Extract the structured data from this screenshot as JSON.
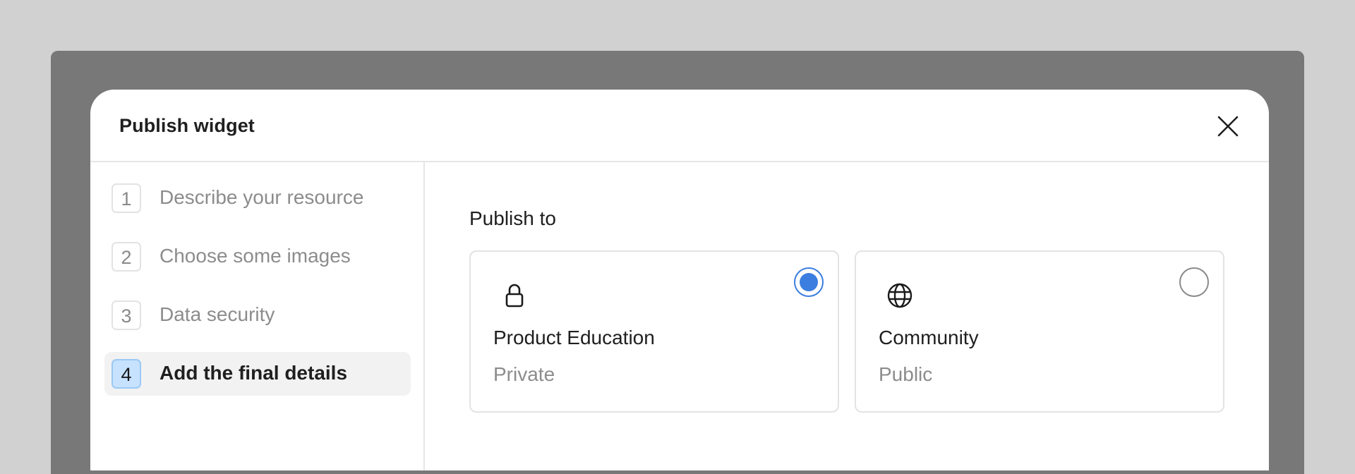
{
  "dialog": {
    "title": "Publish widget",
    "close_icon": "close-icon"
  },
  "steps": [
    {
      "number": "1",
      "label": "Describe your resource",
      "active": false
    },
    {
      "number": "2",
      "label": "Choose some images",
      "active": false
    },
    {
      "number": "3",
      "label": "Data security",
      "active": false
    },
    {
      "number": "4",
      "label": "Add the final details",
      "active": true
    }
  ],
  "publish": {
    "label": "Publish to",
    "options": [
      {
        "title": "Product Education",
        "subtitle": "Private",
        "icon": "lock-icon",
        "selected": true
      },
      {
        "title": "Community",
        "subtitle": "Public",
        "icon": "globe-icon",
        "selected": false
      }
    ]
  },
  "colors": {
    "accent": "#3b7ee0",
    "active_step_badge": "#c7e2ff",
    "backdrop": "#787878"
  }
}
